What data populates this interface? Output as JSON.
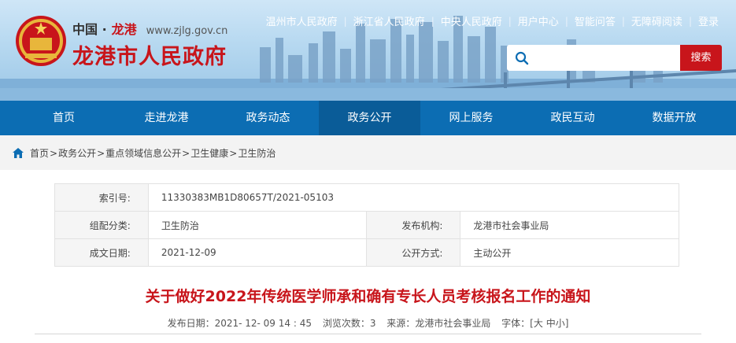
{
  "header": {
    "site_prefix": "中国 ·",
    "site_city": "龙港",
    "site_url": "www.zjlg.gov.cn",
    "site_name": "龙港市人民政府",
    "top_links": [
      "温州市人民政府",
      "浙江省人民政府",
      "中央人民政府",
      "用户中心",
      "智能问答",
      "无障碍阅读",
      "登录"
    ],
    "search": {
      "placeholder": "",
      "button_label": "搜索"
    }
  },
  "nav": {
    "items": [
      "首页",
      "走进龙港",
      "政务动态",
      "政务公开",
      "网上服务",
      "政民互动",
      "数据开放"
    ],
    "active": "政务公开"
  },
  "breadcrumb": [
    "首页",
    "政务公开",
    "重点领域信息公开",
    "卫生健康",
    "卫生防治"
  ],
  "meta": {
    "index_label": "索引号:",
    "index_value": "11330383MB1D80657T/2021-05103",
    "category_label": "组配分类:",
    "category_value": "卫生防治",
    "publisher_label": "发布机构:",
    "publisher_value": "龙港市社会事业局",
    "date_label": "成文日期:",
    "date_value": "2021-12-09",
    "method_label": "公开方式:",
    "method_value": "主动公开"
  },
  "article": {
    "title": "关于做好2022年传统医学师承和确有专长人员考核报名工作的通知",
    "publish_date_label": "发布日期：",
    "publish_date": "2021- 12- 09 14 : 45",
    "views_label": "浏览次数：",
    "views": "3",
    "source_label": "来源：",
    "source": "龙港市社会事业局",
    "font_label": "字体：",
    "font_open": "[",
    "font_large": "大",
    "font_medium": "中",
    "font_small": "小",
    "font_close": "]"
  },
  "colors": {
    "brand_red": "#c8151b",
    "nav_blue": "#0c6db3",
    "nav_active": "#0a5c98"
  }
}
